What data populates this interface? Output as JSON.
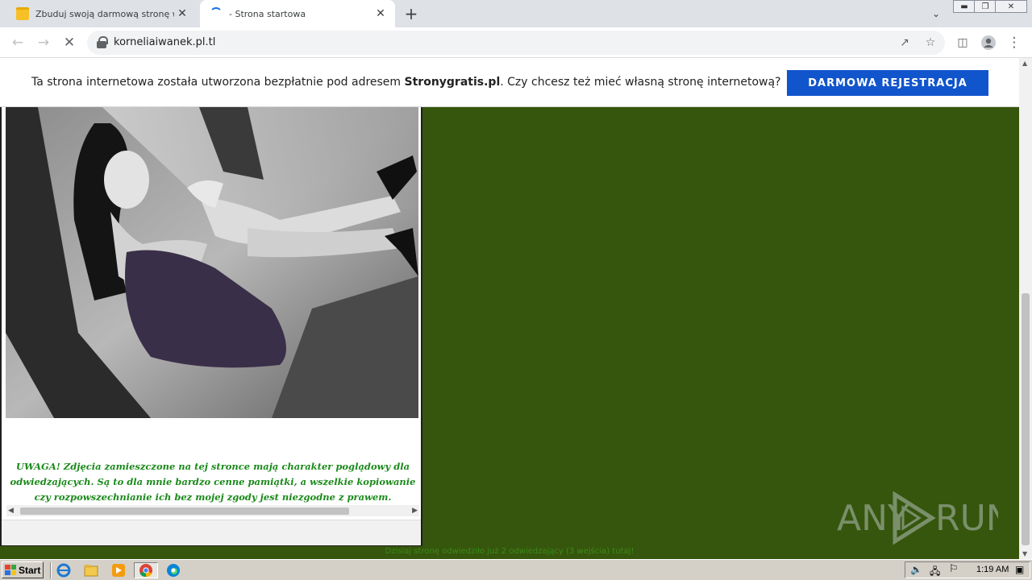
{
  "browser": {
    "tabs": [
      {
        "title": "Zbuduj swoją darmową stronę www",
        "active": false,
        "favicon": "folder-icon"
      },
      {
        "title": "- Strona startowa",
        "active": true,
        "favicon": "loading-spinner-icon"
      }
    ],
    "new_tab_label": "+",
    "close_label": "✕",
    "url": "korneliaiwanek.pl.tl"
  },
  "page": {
    "promo": {
      "text_before": "Ta strona internetowa została utworzona bezpłatnie pod adresem ",
      "brand": "Stronygratis.pl",
      "text_after": ". Czy chcesz też mieć własną stronę internetową?",
      "button_label": "DARMOWA REJESTRACJA",
      "button_color": "#1155cc"
    },
    "notice": "UWAGA! Zdjęcia zamieszczone na tej stronce mają charakter poglądowy dla odwiedzających. Są to dla mnie bardzo cenne pamiątki, a wszelkie kopiowanie czy rozpowszechnianie ich bez mojej zgody jest niezgodne z prawem.",
    "visits": "Dzisiaj stronę odwiedziło już 2 odwiedzający (3 wejścia) tutaj!",
    "background_color": "#36560d",
    "watermark": {
      "left": "ANY",
      "right": "RUN"
    }
  },
  "taskbar": {
    "start_label": "Start",
    "clock": "1:19 AM"
  }
}
